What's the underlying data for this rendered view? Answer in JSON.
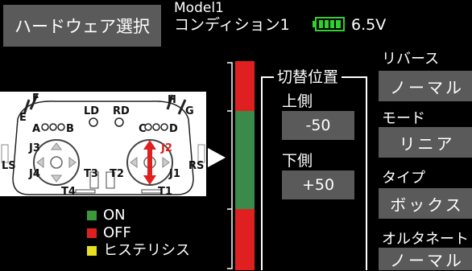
{
  "header": {
    "title_button": "ハードウェア選択",
    "model": "Model1",
    "condition": "コンディション1",
    "voltage": "6.5V"
  },
  "transmitter": {
    "switches": {
      "E": "E",
      "F": "F",
      "H": "H",
      "G": "G",
      "LD": "LD",
      "RD": "RD",
      "A": "A",
      "B": "B",
      "C": "C",
      "D": "D",
      "J3": "J3",
      "J4": "J4",
      "J2": "J2",
      "J1": "J1",
      "T3": "T3",
      "T2": "T2",
      "T4": "T4",
      "T1": "T1",
      "LS": "LS",
      "RS": "RS"
    }
  },
  "legend": [
    {
      "label": "ON",
      "color": "#3a9a3a"
    },
    {
      "label": "OFF",
      "color": "#e02020"
    },
    {
      "label": "ヒステリシス",
      "color": "#e6e020"
    }
  ],
  "gauge": {
    "segments": [
      {
        "state": "off",
        "color": "#e02020"
      },
      {
        "state": "on",
        "color": "#3a8a4a"
      },
      {
        "state": "off",
        "color": "#e02020"
      }
    ]
  },
  "switch_position": {
    "title": "切替位置",
    "upper_label": "上側",
    "upper_value": "-50",
    "lower_label": "下側",
    "lower_value": "+50"
  },
  "right_panel": {
    "reverse_label": "リバース",
    "reverse_value": "ノーマル",
    "mode_label": "モード",
    "mode_value": "リニア",
    "type_label": "タイプ",
    "type_value": "ボックス",
    "alternate_label": "オルタネート",
    "alternate_value": "ノーマル"
  },
  "colors": {
    "button_gray": "#5a5a5a",
    "battery_green": "#2fd02f",
    "highlight_red": "#e02020"
  }
}
